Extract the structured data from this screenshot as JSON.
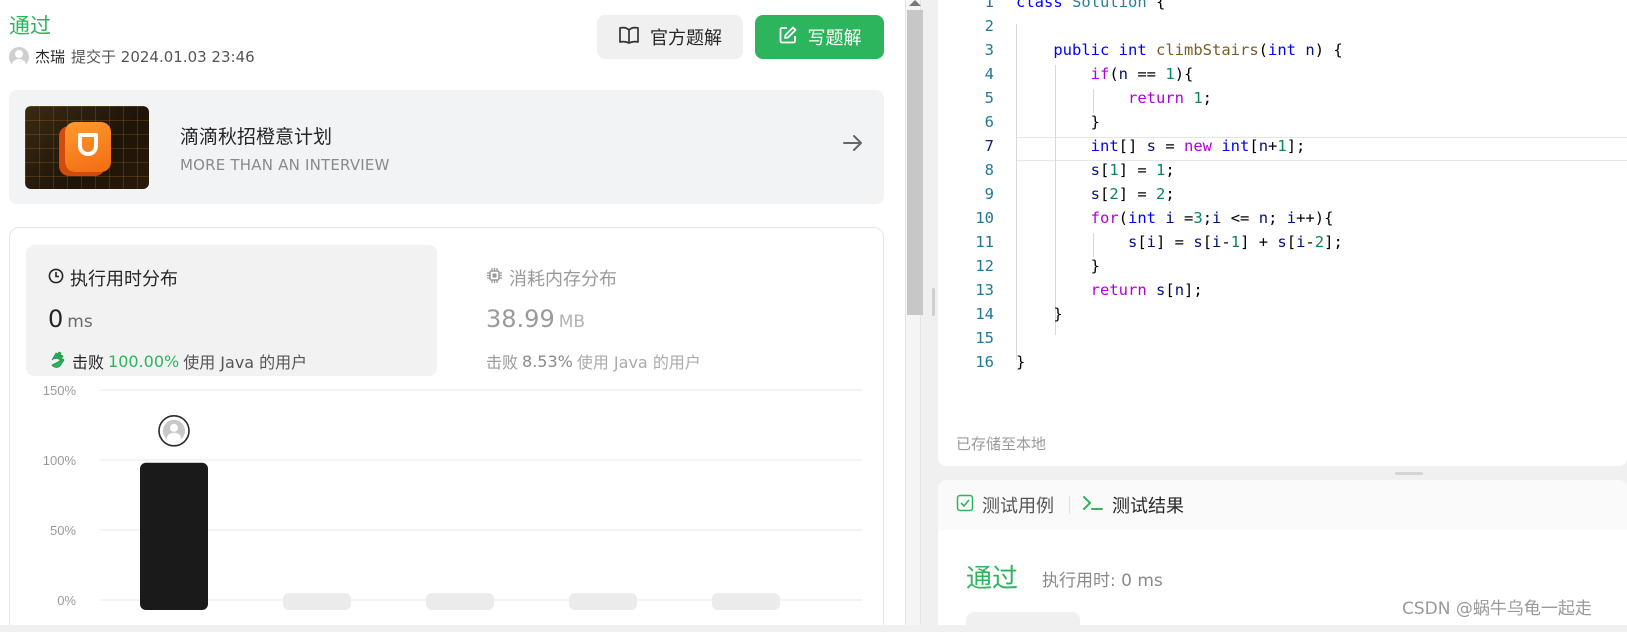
{
  "submission": {
    "status": "通过",
    "author": "杰瑞",
    "submitted_text": "提交于 2024.01.03 23:46"
  },
  "header_buttons": {
    "official_solution": "官方题解",
    "write_solution": "写题解"
  },
  "banner": {
    "title": "滴滴秋招橙意计划",
    "subtitle": "MORE THAN AN INTERVIEW"
  },
  "runtime": {
    "title": "执行用时分布",
    "value": "0",
    "unit": "ms",
    "beat_label": "击败",
    "beat_pct": "100.00%",
    "beat_rest": "使用 Java 的用户"
  },
  "memory": {
    "title": "消耗内存分布",
    "value": "38.99",
    "unit": "MB",
    "beat_label": "击败",
    "beat_pct": "8.53%",
    "beat_rest": "使用 Java 的用户"
  },
  "chart_data": {
    "type": "bar",
    "y_ticks": [
      "150%",
      "100%",
      "50%",
      "0%"
    ],
    "ylim": [
      0,
      150
    ],
    "values": [
      98,
      5,
      5,
      5,
      5
    ],
    "highlight_index": 0,
    "colors": {
      "highlight": "#1a1a1a",
      "other": "#ebebeb",
      "grid": "#e8e8e8"
    }
  },
  "editor": {
    "line_numbers": [
      "1",
      "2",
      "3",
      "4",
      "5",
      "6",
      "7",
      "8",
      "9",
      "10",
      "11",
      "12",
      "13",
      "14",
      "15",
      "16"
    ],
    "saved_status": "已存储至本地"
  },
  "test_panel": {
    "tab_cases": "测试用例",
    "tab_results": "测试结果",
    "result_status": "通过",
    "runtime_text": "执行用时: 0 ms"
  },
  "watermark": "CSDN @蜗牛乌龟一起走",
  "colors": {
    "accent": "#2db55d",
    "keyword": "#0000ff",
    "control": "#af00db",
    "number": "#098658"
  }
}
